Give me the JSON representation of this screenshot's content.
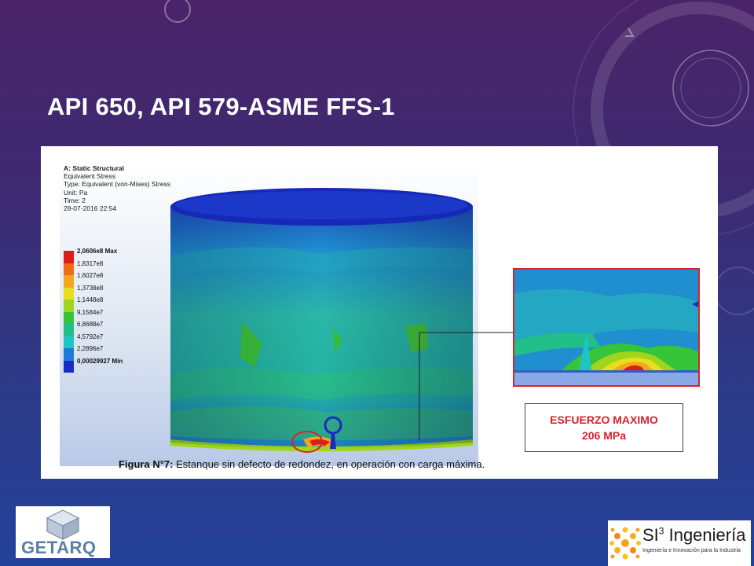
{
  "slide": {
    "title": "API 650, API 579-ASME FFS-1"
  },
  "simulation": {
    "header": {
      "title": "A: Static Structural",
      "line1": "Equivalent Stress",
      "line2": "Type: Equivalent (von-Mises) Stress",
      "line3": "Unit: Pa",
      "line4": "Time: 2",
      "line5": "28-07-2016 22:54"
    },
    "legend": [
      {
        "label": "2,0606e8 Max",
        "color": "#e01b1b"
      },
      {
        "label": "1,8317e8",
        "color": "#ee6b17"
      },
      {
        "label": "1,6027e8",
        "color": "#f2a81d"
      },
      {
        "label": "1,3738e8",
        "color": "#e9dd1e"
      },
      {
        "label": "1,1448e8",
        "color": "#9fd61d"
      },
      {
        "label": "9,1584e7",
        "color": "#35c43a"
      },
      {
        "label": "6,8688e7",
        "color": "#22bf88"
      },
      {
        "label": "4,5792e7",
        "color": "#1fc4c4"
      },
      {
        "label": "2,2896e7",
        "color": "#1e7ad8"
      },
      {
        "label": "0,00029927 Min",
        "color": "#1a2bc6"
      }
    ]
  },
  "callout": {
    "line1": "ESFUERZO MAXIMO",
    "line2": "206 MPa"
  },
  "caption": {
    "label": "Figura N°7:",
    "text": " Estanque sin defecto de redondez, en operación con carga máxima."
  },
  "logos": {
    "left": "GETARQ",
    "right_main": "SI",
    "right_sup": "3",
    "right_rest": " Ingeniería",
    "right_tagline": "Ingeniería e Innovación para la Industria"
  },
  "colors": {
    "accent_red": "#d8232a",
    "bg_top": "#4a2468",
    "bg_bottom": "#23429a"
  }
}
